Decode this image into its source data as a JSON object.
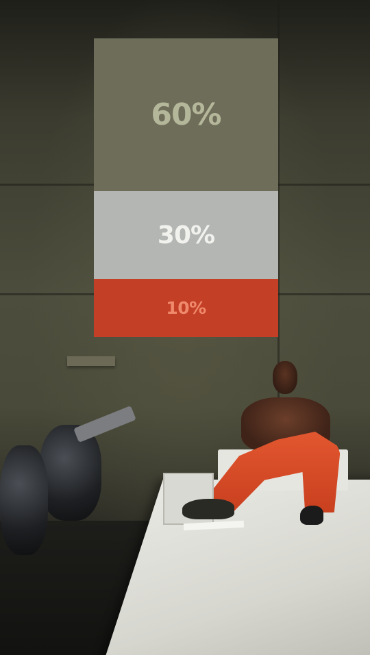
{
  "palette": {
    "segments": [
      {
        "label": "60%",
        "value": 60,
        "color": "#6d6d5a",
        "text_color": "#b5b79a"
      },
      {
        "label": "30%",
        "value": 30,
        "color": "#b3b6b3",
        "text_color": "#f1f2ee"
      },
      {
        "label": "10%",
        "value": 10,
        "color": "#c33f25",
        "text_color": "#f08a6c"
      }
    ]
  }
}
